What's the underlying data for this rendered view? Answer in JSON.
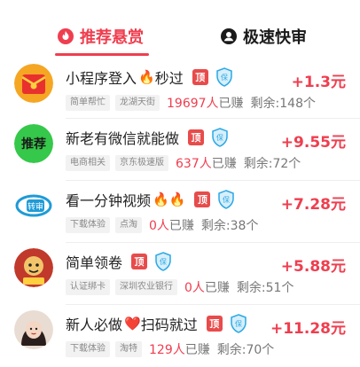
{
  "tabs": {
    "recommend": {
      "label": "推荐悬赏",
      "icon": "fire-icon",
      "active": true
    },
    "fast": {
      "label": "极速快审",
      "icon": "person-icon",
      "active": false
    }
  },
  "colors": {
    "accent": "#ef3e4f",
    "top_badge": "#e84b4b",
    "shield": "#29a8e6",
    "tag_bg": "#f2f2f2"
  },
  "tasks": [
    {
      "title": "小程序登入",
      "title_suffix": "秒过",
      "emoji": "🔥",
      "badge": "顶",
      "tags": [
        "简单帮忙",
        "龙湖天街"
      ],
      "count": "19697人",
      "earned": "已赚",
      "remaining": "剩余:148个",
      "reward": "+1.3元",
      "avatar": "red-envelope-avatar"
    },
    {
      "title": "新老有微信就能做",
      "title_suffix": "",
      "emoji": "",
      "badge": "顶",
      "tags": [
        "电商相关",
        "京东极速版"
      ],
      "count": "637人",
      "earned": "已赚",
      "remaining": "剩余:72个",
      "reward": "+9.55元",
      "avatar": "recommend-avatar"
    },
    {
      "title": "看一分钟视频",
      "title_suffix": "",
      "emoji": "🔥🔥",
      "badge": "顶",
      "tags": [
        "下载体验",
        "点淘"
      ],
      "count": "0人",
      "earned": "已赚",
      "remaining": "剩余:38个",
      "reward": "+7.28元",
      "avatar": "blue-logo-avatar"
    },
    {
      "title": "简单领卷",
      "title_suffix": "",
      "emoji": "",
      "badge": "顶",
      "tags": [
        "认证绑卡",
        "深圳农业银行"
      ],
      "count": "0人",
      "earned": "已赚",
      "remaining": "剩余:51个",
      "reward": "+5.88元",
      "avatar": "mascot-avatar"
    },
    {
      "title": "新人必做",
      "title_suffix": "扫码就过",
      "emoji": "❤️",
      "badge": "顶",
      "tags": [
        "下载体验",
        "淘特"
      ],
      "count": "129人",
      "earned": "已赚",
      "remaining": "剩余:70个",
      "reward": "+11.28元",
      "avatar": "girl-avatar"
    }
  ]
}
